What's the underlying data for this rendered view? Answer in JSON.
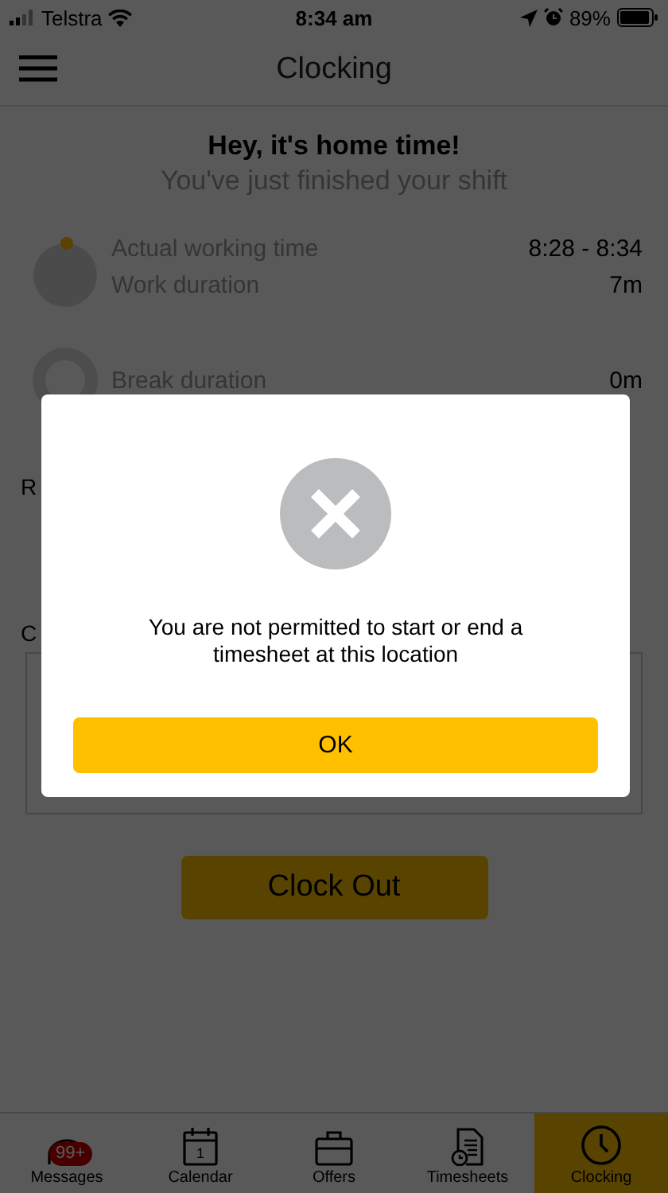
{
  "status_bar": {
    "carrier": "Telstra",
    "time": "8:34 am",
    "battery": "89%"
  },
  "header": {
    "title": "Clocking"
  },
  "summary": {
    "heading": "Hey, it's home time!",
    "subtitle": "You've just finished your shift",
    "rows": [
      {
        "label": "Actual working time",
        "value": "8:28 - 8:34"
      },
      {
        "label": "Work duration",
        "value": "7m"
      },
      {
        "label": "Break duration",
        "value": "0m"
      }
    ]
  },
  "field_labels": [
    "R",
    "C"
  ],
  "clock_out_button": "Clock Out",
  "tab_bar": [
    {
      "label": "Messages",
      "selected": false,
      "badge": "99+"
    },
    {
      "label": "Calendar",
      "selected": false,
      "icon_text": "1"
    },
    {
      "label": "Offers",
      "selected": false
    },
    {
      "label": "Timesheets",
      "selected": false
    },
    {
      "label": "Clocking",
      "selected": true
    }
  ],
  "dialog": {
    "message": "You are not permitted to start or end a timesheet at this location",
    "button": "OK"
  }
}
